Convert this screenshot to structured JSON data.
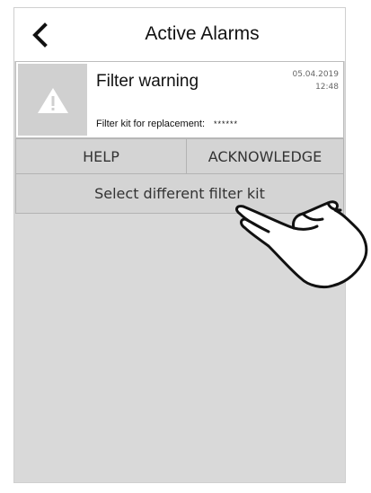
{
  "header": {
    "back_icon": "chevron-left-icon",
    "title": "Active Alarms"
  },
  "alarm": {
    "icon": "warning-triangle-icon",
    "title": "Filter warning",
    "date": "05.04.2019",
    "time": "12:48",
    "detail_label": "Filter kit for replacement:",
    "detail_value": "******"
  },
  "actions": {
    "help_label": "HELP",
    "acknowledge_label": "ACKNOWLEDGE",
    "select_label": "Select different filter kit"
  },
  "overlay": {
    "icon": "pointing-hand-icon"
  },
  "colors": {
    "background": "#d9d9d9",
    "button": "#d4d4d4",
    "icon_box": "#d0d0d0"
  }
}
